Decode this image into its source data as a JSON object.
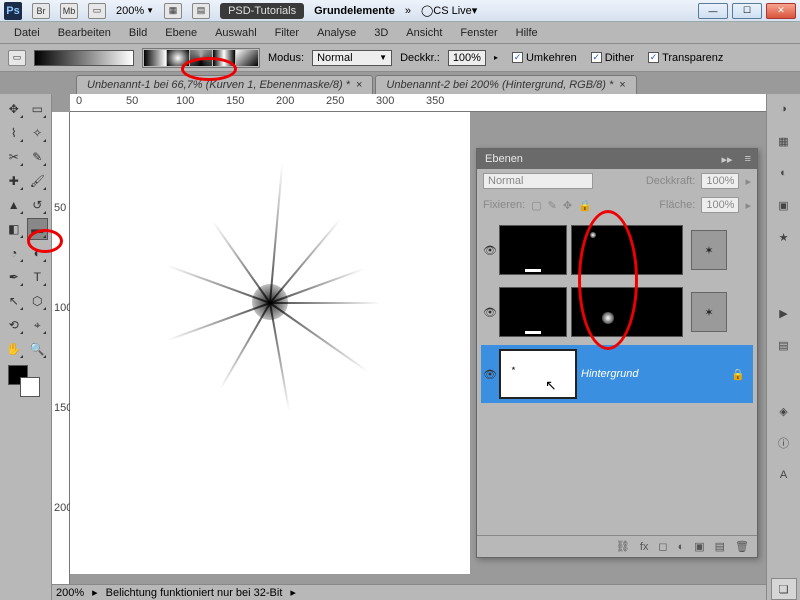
{
  "title": {
    "zoom_label": "200%",
    "psd_tutorials": "PSD-Tutorials",
    "grundelemente": "Grundelemente",
    "cs_live": "CS Live",
    "br": "Br",
    "mb": "Mb"
  },
  "menu": [
    "Datei",
    "Bearbeiten",
    "Bild",
    "Ebene",
    "Auswahl",
    "Filter",
    "Analyse",
    "3D",
    "Ansicht",
    "Fenster",
    "Hilfe"
  ],
  "optbar": {
    "modus_label": "Modus:",
    "modus_value": "Normal",
    "deckkr_label": "Deckkr.:",
    "deckkr_value": "100%",
    "umkehren": "Umkehren",
    "dither": "Dither",
    "transparenz": "Transparenz"
  },
  "tabs": [
    "Unbenannt-1 bei 66,7% (Kurven 1, Ebenenmaske/8) *",
    "Unbenannt-2 bei 200% (Hintergrund, RGB/8) *"
  ],
  "ruler_h": [
    "0",
    "50",
    "100",
    "150",
    "200",
    "250",
    "300",
    "350"
  ],
  "ruler_v": [
    "50",
    "100",
    "150",
    "200"
  ],
  "status": {
    "zoom": "200%",
    "msg": "Belichtung funktioniert nur bei 32-Bit"
  },
  "panel": {
    "title": "Ebenen",
    "blend": "Normal",
    "deckkraft_label": "Deckkraft:",
    "deckkraft_value": "100%",
    "fix_label": "Fixieren:",
    "flaeche_label": "Fläche:",
    "flaeche_value": "100%",
    "bg_label": "Hintergrund"
  }
}
